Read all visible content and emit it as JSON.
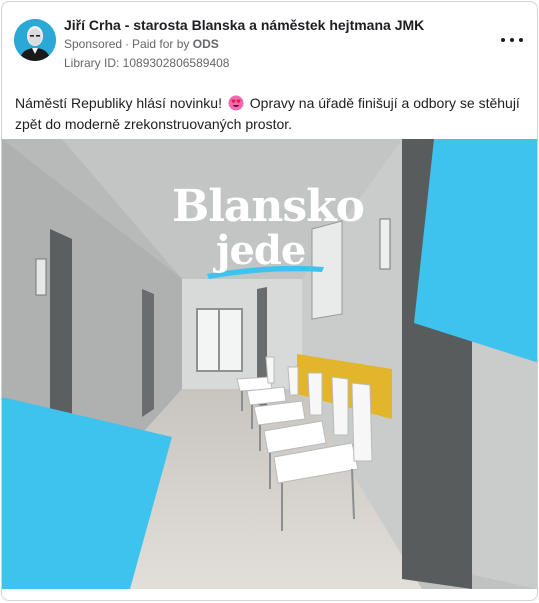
{
  "post": {
    "page_name": "Jiří Crha - starosta Blanska a náměstek hejtmana JMK",
    "sponsored": "Sponsored",
    "paid_for_prefix": "Paid for by",
    "paid_for_by": "ODS",
    "library_id": "Library ID: 1089302806589408",
    "text_before_emoji": "Náměstí Republiky hlásí novinku!",
    "emoji_icon": "smiling-face-with-heart-eyes-emoji",
    "text_after_emoji": "Opravy na úřadě finišují a odbory se stěhují zpět do moderně zrekonstruovaných prostor."
  },
  "media": {
    "logo_line1": "Blansko",
    "logo_line2": "jede",
    "accent_color": "#3ec3ef",
    "wall_color": "#c9ccca",
    "floor_color": "#d7d4cf",
    "panel_color": "#e6b829"
  }
}
